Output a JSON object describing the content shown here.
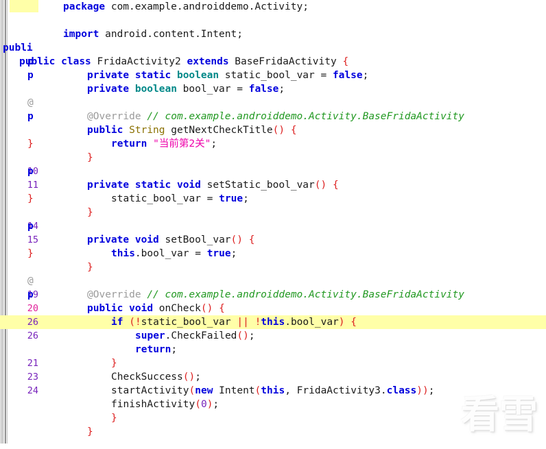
{
  "viewer": {
    "kind": "decompiled-java-source-view",
    "language": "Java",
    "current_line": "20",
    "highlight_color": "#ffffA8",
    "line_number_color": "#7722bb",
    "current_line_number_color": "#e0219a"
  },
  "watermark": {
    "text": "看雪",
    "icon": "snowflake-icon"
  },
  "gutter": [
    {
      "num": "",
      "ghost": "",
      "ghost_kind": ""
    },
    {
      "num": "",
      "ghost": "",
      "ghost_kind": ""
    },
    {
      "num": "",
      "ghost": "",
      "ghost_kind": ""
    },
    {
      "num": "",
      "ghost": "publi",
      "ghost_kind": "kw"
    },
    {
      "num": "",
      "ghost": "p",
      "ghost_kind": "kw"
    },
    {
      "num": "",
      "ghost": "p",
      "ghost_kind": "kw"
    },
    {
      "num": "",
      "ghost": "",
      "ghost_kind": ""
    },
    {
      "num": "",
      "ghost": "@",
      "ghost_kind": "dim"
    },
    {
      "num": "",
      "ghost": "p",
      "ghost_kind": "kw"
    },
    {
      "num": "",
      "ghost": "",
      "ghost_kind": ""
    },
    {
      "num": "",
      "ghost": "}",
      "ghost_kind": "brace"
    },
    {
      "num": "",
      "ghost": "",
      "ghost_kind": ""
    },
    {
      "num": "10",
      "ghost": "p",
      "ghost_kind": "kw"
    },
    {
      "num": "11",
      "ghost": "",
      "ghost_kind": ""
    },
    {
      "num": "",
      "ghost": "}",
      "ghost_kind": "brace"
    },
    {
      "num": "",
      "ghost": "",
      "ghost_kind": ""
    },
    {
      "num": "14",
      "ghost": "p",
      "ghost_kind": "kw"
    },
    {
      "num": "15",
      "ghost": "",
      "ghost_kind": ""
    },
    {
      "num": "",
      "ghost": "}",
      "ghost_kind": "brace"
    },
    {
      "num": "",
      "ghost": "",
      "ghost_kind": ""
    },
    {
      "num": "",
      "ghost": "@",
      "ghost_kind": "dim"
    },
    {
      "num": "19",
      "ghost": "p",
      "ghost_kind": "kw"
    },
    {
      "num": "20",
      "ghost": "",
      "ghost_kind": ""
    },
    {
      "num": "26",
      "ghost": "",
      "ghost_kind": ""
    },
    {
      "num": "26",
      "ghost": "",
      "ghost_kind": ""
    },
    {
      "num": "",
      "ghost": "",
      "ghost_kind": ""
    },
    {
      "num": "21",
      "ghost": "",
      "ghost_kind": ""
    },
    {
      "num": "23",
      "ghost": "",
      "ghost_kind": ""
    },
    {
      "num": "24",
      "ghost": "",
      "ghost_kind": ""
    },
    {
      "num": "",
      "ghost": "",
      "ghost_kind": ""
    },
    {
      "num": "",
      "ghost": "",
      "ghost_kind": ""
    }
  ],
  "code_lines": [
    {
      "indent": 0,
      "highlight": false,
      "tokens": [
        {
          "t": "package",
          "c": "kw"
        },
        {
          "t": " com.example.androiddemo.Activity",
          "c": "id"
        },
        {
          "t": ";",
          "c": "semi"
        }
      ]
    },
    {
      "indent": 0,
      "highlight": false,
      "tokens": []
    },
    {
      "indent": 0,
      "highlight": false,
      "tokens": [
        {
          "t": "import",
          "c": "kw"
        },
        {
          "t": " android.content.Intent",
          "c": "id"
        },
        {
          "t": ";",
          "c": "semi"
        }
      ]
    },
    {
      "indent": 0,
      "highlight": false,
      "tokens": []
    },
    {
      "indent": -1,
      "highlight": false,
      "tokens": [
        {
          "t": "public",
          "c": "kw"
        },
        {
          "t": " ",
          "c": "id"
        },
        {
          "t": "class",
          "c": "kw"
        },
        {
          "t": " FridaActivity2 ",
          "c": "id"
        },
        {
          "t": "extends",
          "c": "kw"
        },
        {
          "t": " BaseFridaActivity ",
          "c": "id"
        },
        {
          "t": "{",
          "c": "pun"
        }
      ]
    },
    {
      "indent": 1,
      "highlight": false,
      "tokens": [
        {
          "t": "private",
          "c": "kw"
        },
        {
          "t": " ",
          "c": "id"
        },
        {
          "t": "static",
          "c": "kw"
        },
        {
          "t": " ",
          "c": "id"
        },
        {
          "t": "boolean",
          "c": "typ"
        },
        {
          "t": " static_bool_var = ",
          "c": "id"
        },
        {
          "t": "false",
          "c": "kw"
        },
        {
          "t": ";",
          "c": "semi"
        }
      ]
    },
    {
      "indent": 1,
      "highlight": false,
      "tokens": [
        {
          "t": "private",
          "c": "kw"
        },
        {
          "t": " ",
          "c": "id"
        },
        {
          "t": "boolean",
          "c": "typ"
        },
        {
          "t": " bool_var = ",
          "c": "id"
        },
        {
          "t": "false",
          "c": "kw"
        },
        {
          "t": ";",
          "c": "semi"
        }
      ]
    },
    {
      "indent": 0,
      "highlight": false,
      "tokens": []
    },
    {
      "indent": 1,
      "highlight": false,
      "tokens": [
        {
          "t": "@Override",
          "c": "ann"
        },
        {
          "t": " ",
          "c": "id"
        },
        {
          "t": "// com.example.androiddemo.Activity.BaseFridaActivity",
          "c": "cmt"
        }
      ]
    },
    {
      "indent": 1,
      "highlight": false,
      "tokens": [
        {
          "t": "public",
          "c": "kw"
        },
        {
          "t": " ",
          "c": "id"
        },
        {
          "t": "String",
          "c": "cls"
        },
        {
          "t": " getNextCheckTitle",
          "c": "id"
        },
        {
          "t": "()",
          "c": "pun"
        },
        {
          "t": " ",
          "c": "id"
        },
        {
          "t": "{",
          "c": "pun"
        }
      ]
    },
    {
      "indent": 2,
      "highlight": false,
      "tokens": [
        {
          "t": "return",
          "c": "kw"
        },
        {
          "t": " ",
          "c": "id"
        },
        {
          "t": "\"当前第2关\"",
          "c": "str"
        },
        {
          "t": ";",
          "c": "semi"
        }
      ]
    },
    {
      "indent": 1,
      "highlight": false,
      "tokens": [
        {
          "t": "}",
          "c": "pun"
        }
      ]
    },
    {
      "indent": 0,
      "highlight": false,
      "tokens": []
    },
    {
      "indent": 1,
      "highlight": false,
      "tokens": [
        {
          "t": "private",
          "c": "kw"
        },
        {
          "t": " ",
          "c": "id"
        },
        {
          "t": "static",
          "c": "kw"
        },
        {
          "t": " ",
          "c": "id"
        },
        {
          "t": "void",
          "c": "kw"
        },
        {
          "t": " setStatic_bool_var",
          "c": "id"
        },
        {
          "t": "()",
          "c": "pun"
        },
        {
          "t": " ",
          "c": "id"
        },
        {
          "t": "{",
          "c": "pun"
        }
      ]
    },
    {
      "indent": 2,
      "highlight": false,
      "tokens": [
        {
          "t": "static_bool_var = ",
          "c": "id"
        },
        {
          "t": "true",
          "c": "kw"
        },
        {
          "t": ";",
          "c": "semi"
        }
      ]
    },
    {
      "indent": 1,
      "highlight": false,
      "tokens": [
        {
          "t": "}",
          "c": "pun"
        }
      ]
    },
    {
      "indent": 0,
      "highlight": false,
      "tokens": []
    },
    {
      "indent": 1,
      "highlight": false,
      "tokens": [
        {
          "t": "private",
          "c": "kw"
        },
        {
          "t": " ",
          "c": "id"
        },
        {
          "t": "void",
          "c": "kw"
        },
        {
          "t": " setBool_var",
          "c": "id"
        },
        {
          "t": "()",
          "c": "pun"
        },
        {
          "t": " ",
          "c": "id"
        },
        {
          "t": "{",
          "c": "pun"
        }
      ]
    },
    {
      "indent": 2,
      "highlight": false,
      "tokens": [
        {
          "t": "this",
          "c": "kw"
        },
        {
          "t": ".bool_var = ",
          "c": "id"
        },
        {
          "t": "true",
          "c": "kw"
        },
        {
          "t": ";",
          "c": "semi"
        }
      ]
    },
    {
      "indent": 1,
      "highlight": false,
      "tokens": [
        {
          "t": "}",
          "c": "pun"
        }
      ]
    },
    {
      "indent": 0,
      "highlight": false,
      "tokens": []
    },
    {
      "indent": 1,
      "highlight": false,
      "tokens": [
        {
          "t": "@Override",
          "c": "ann"
        },
        {
          "t": " ",
          "c": "id"
        },
        {
          "t": "// com.example.androiddemo.Activity.BaseFridaActivity",
          "c": "cmt"
        }
      ]
    },
    {
      "indent": 1,
      "highlight": false,
      "tokens": [
        {
          "t": "public",
          "c": "kw"
        },
        {
          "t": " ",
          "c": "id"
        },
        {
          "t": "void",
          "c": "kw"
        },
        {
          "t": " onCheck",
          "c": "id"
        },
        {
          "t": "()",
          "c": "pun"
        },
        {
          "t": " ",
          "c": "id"
        },
        {
          "t": "{",
          "c": "pun"
        }
      ]
    },
    {
      "indent": 2,
      "highlight": true,
      "tokens": [
        {
          "t": "if",
          "c": "kw"
        },
        {
          "t": " ",
          "c": "id"
        },
        {
          "t": "(",
          "c": "pun"
        },
        {
          "t": "!",
          "c": "pun"
        },
        {
          "t": "static_bool_var ",
          "c": "id"
        },
        {
          "t": "||",
          "c": "pun"
        },
        {
          "t": " ",
          "c": "id"
        },
        {
          "t": "!",
          "c": "pun"
        },
        {
          "t": "this",
          "c": "kw"
        },
        {
          "t": ".bool_var",
          "c": "id"
        },
        {
          "t": ")",
          "c": "pun"
        },
        {
          "t": " ",
          "c": "id"
        },
        {
          "t": "{",
          "c": "pun"
        }
      ]
    },
    {
      "indent": 3,
      "highlight": false,
      "tokens": [
        {
          "t": "super",
          "c": "kw"
        },
        {
          "t": ".CheckFailed",
          "c": "id"
        },
        {
          "t": "()",
          "c": "pun"
        },
        {
          "t": ";",
          "c": "semi"
        }
      ]
    },
    {
      "indent": 3,
      "highlight": false,
      "tokens": [
        {
          "t": "return",
          "c": "kw"
        },
        {
          "t": ";",
          "c": "semi"
        }
      ]
    },
    {
      "indent": 2,
      "highlight": false,
      "tokens": [
        {
          "t": "}",
          "c": "pun"
        }
      ]
    },
    {
      "indent": 2,
      "highlight": false,
      "tokens": [
        {
          "t": "CheckSuccess",
          "c": "id"
        },
        {
          "t": "()",
          "c": "pun"
        },
        {
          "t": ";",
          "c": "semi"
        }
      ]
    },
    {
      "indent": 2,
      "highlight": false,
      "tokens": [
        {
          "t": "startActivity",
          "c": "id"
        },
        {
          "t": "(",
          "c": "pun"
        },
        {
          "t": "new",
          "c": "kw"
        },
        {
          "t": " Intent",
          "c": "id"
        },
        {
          "t": "(",
          "c": "pun"
        },
        {
          "t": "this",
          "c": "kw"
        },
        {
          "t": ", FridaActivity3.",
          "c": "id"
        },
        {
          "t": "class",
          "c": "kw"
        },
        {
          "t": "))",
          "c": "pun"
        },
        {
          "t": ";",
          "c": "semi"
        }
      ]
    },
    {
      "indent": 2,
      "highlight": false,
      "tokens": [
        {
          "t": "finishActivity",
          "c": "id"
        },
        {
          "t": "(",
          "c": "pun"
        },
        {
          "t": "0",
          "c": "num"
        },
        {
          "t": ")",
          "c": "pun"
        },
        {
          "t": ";",
          "c": "semi"
        }
      ]
    },
    {
      "indent": 2,
      "highlight": false,
      "tokens": [
        {
          "t": "}",
          "c": "pun"
        }
      ]
    },
    {
      "indent": 1,
      "highlight": false,
      "tokens": [
        {
          "t": "}",
          "c": "pun"
        }
      ]
    }
  ]
}
